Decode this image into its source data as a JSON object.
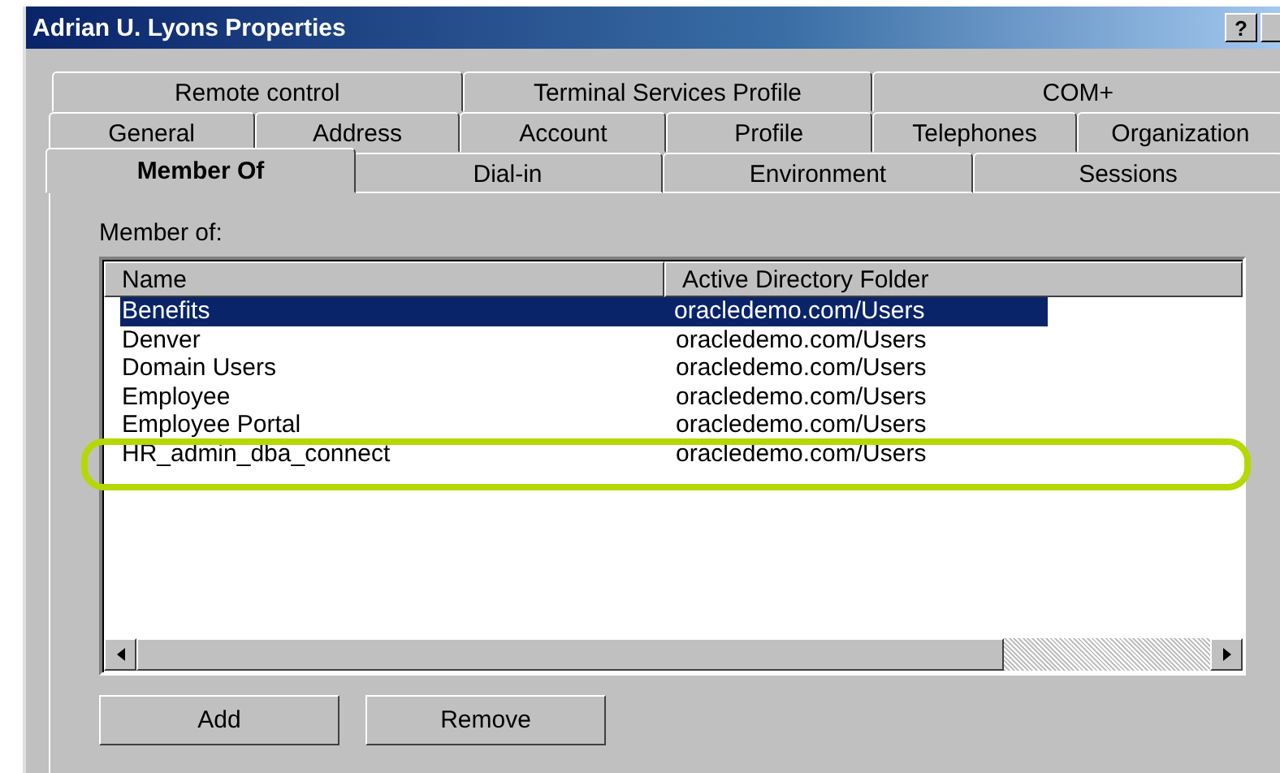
{
  "window": {
    "title": "Adrian U. Lyons Properties",
    "help_button": "?"
  },
  "tab_rows": [
    [
      {
        "label": "Remote control",
        "selected": false
      },
      {
        "label": "Terminal Services Profile",
        "selected": false
      },
      {
        "label": "COM+",
        "selected": false
      }
    ],
    [
      {
        "label": "General",
        "selected": false
      },
      {
        "label": "Address",
        "selected": false
      },
      {
        "label": "Account",
        "selected": false
      },
      {
        "label": "Profile",
        "selected": false
      },
      {
        "label": "Telephones",
        "selected": false
      },
      {
        "label": "Organization",
        "selected": false
      }
    ],
    [
      {
        "label": "Member Of",
        "selected": true
      },
      {
        "label": "Dial-in",
        "selected": false
      },
      {
        "label": "Environment",
        "selected": false
      },
      {
        "label": "Sessions",
        "selected": false
      }
    ]
  ],
  "member_of": {
    "label": "Member of:",
    "columns": [
      "Name",
      "Active Directory Folder"
    ],
    "rows": [
      {
        "name": "Benefits",
        "folder": "oracledemo.com/Users",
        "selected": true,
        "highlighted": false
      },
      {
        "name": "Denver",
        "folder": "oracledemo.com/Users",
        "selected": false,
        "highlighted": false
      },
      {
        "name": "Domain Users",
        "folder": "oracledemo.com/Users",
        "selected": false,
        "highlighted": false
      },
      {
        "name": "Employee",
        "folder": "oracledemo.com/Users",
        "selected": false,
        "highlighted": false
      },
      {
        "name": "Employee Portal",
        "folder": "oracledemo.com/Users",
        "selected": false,
        "highlighted": false
      },
      {
        "name": "HR_admin_dba_connect",
        "folder": "oracledemo.com/Users",
        "selected": false,
        "highlighted": true
      }
    ]
  },
  "buttons": [
    "Add",
    "Remove"
  ]
}
